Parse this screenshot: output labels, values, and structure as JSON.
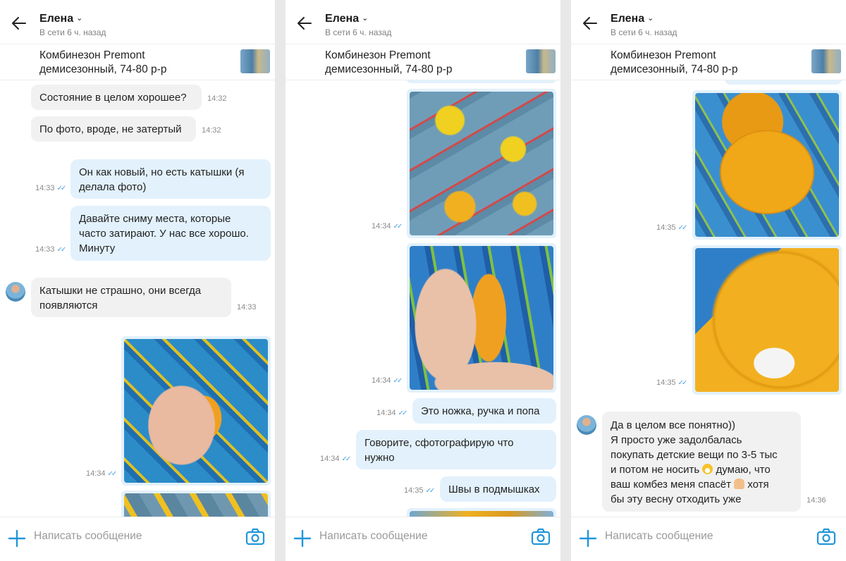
{
  "chat": {
    "contact_name": "Елена",
    "status": "В сети 6 ч. назад",
    "product_title_line1": "Комбинезон Premont",
    "product_title_line2": "демисезонный, 74-80 р-р",
    "input_placeholder": "Написать сообщение"
  },
  "icons": {
    "back": "arrow-left-icon",
    "chevron": "chevron-down-icon",
    "attach": "plus-icon",
    "camera": "camera-icon",
    "read": "double-check-icon"
  },
  "colors": {
    "accent": "#2196d8",
    "incoming_bubble": "#f1f1f2",
    "outgoing_bubble": "#e2f1fc",
    "read_ticks": "#4ea3e0"
  },
  "panel1": {
    "messages": [
      {
        "text": "Состояние в целом хорошее?",
        "time": "14:32"
      },
      {
        "text": "По фото, вроде, не затертый",
        "time": "14:32"
      },
      {
        "line1": "Он как новый, но есть катышки (я",
        "line2": "делала фото)",
        "time": "14:33"
      },
      {
        "line1": "Давайте сниму места, которые",
        "line2": "часто затирают. У нас все хорошо.",
        "line3": "Минуту",
        "time": "14:33"
      },
      {
        "line1": "Катышки не страшно, они всегда",
        "line2": "появляются",
        "time": "14:33"
      },
      {
        "time": "14:34"
      }
    ]
  },
  "panel2": {
    "messages": [
      {
        "time": "14:34"
      },
      {
        "time": "14:34"
      },
      {
        "text": "Это ножка, ручка и попа",
        "time": "14:34"
      },
      {
        "line1": "Говорите, сфотографирую что",
        "line2": "нужно",
        "time": "14:34"
      },
      {
        "text": "Швы в подмышках",
        "time": "14:35"
      }
    ]
  },
  "panel3": {
    "messages": [
      {
        "time": "14:35"
      },
      {
        "time": "14:35"
      },
      {
        "line1": "Да в целом все понятно))",
        "line2": "Я просто уже задолбалась",
        "line3": "покупать детские вещи по 3-5 тыс",
        "line4a": "и потом не носить",
        "line4b": "думаю, что",
        "line5a": "ваш комбез меня спасёт",
        "line5b": "хотя",
        "line6": "бы эту весну отходить уже",
        "time": "14:36"
      }
    ]
  }
}
